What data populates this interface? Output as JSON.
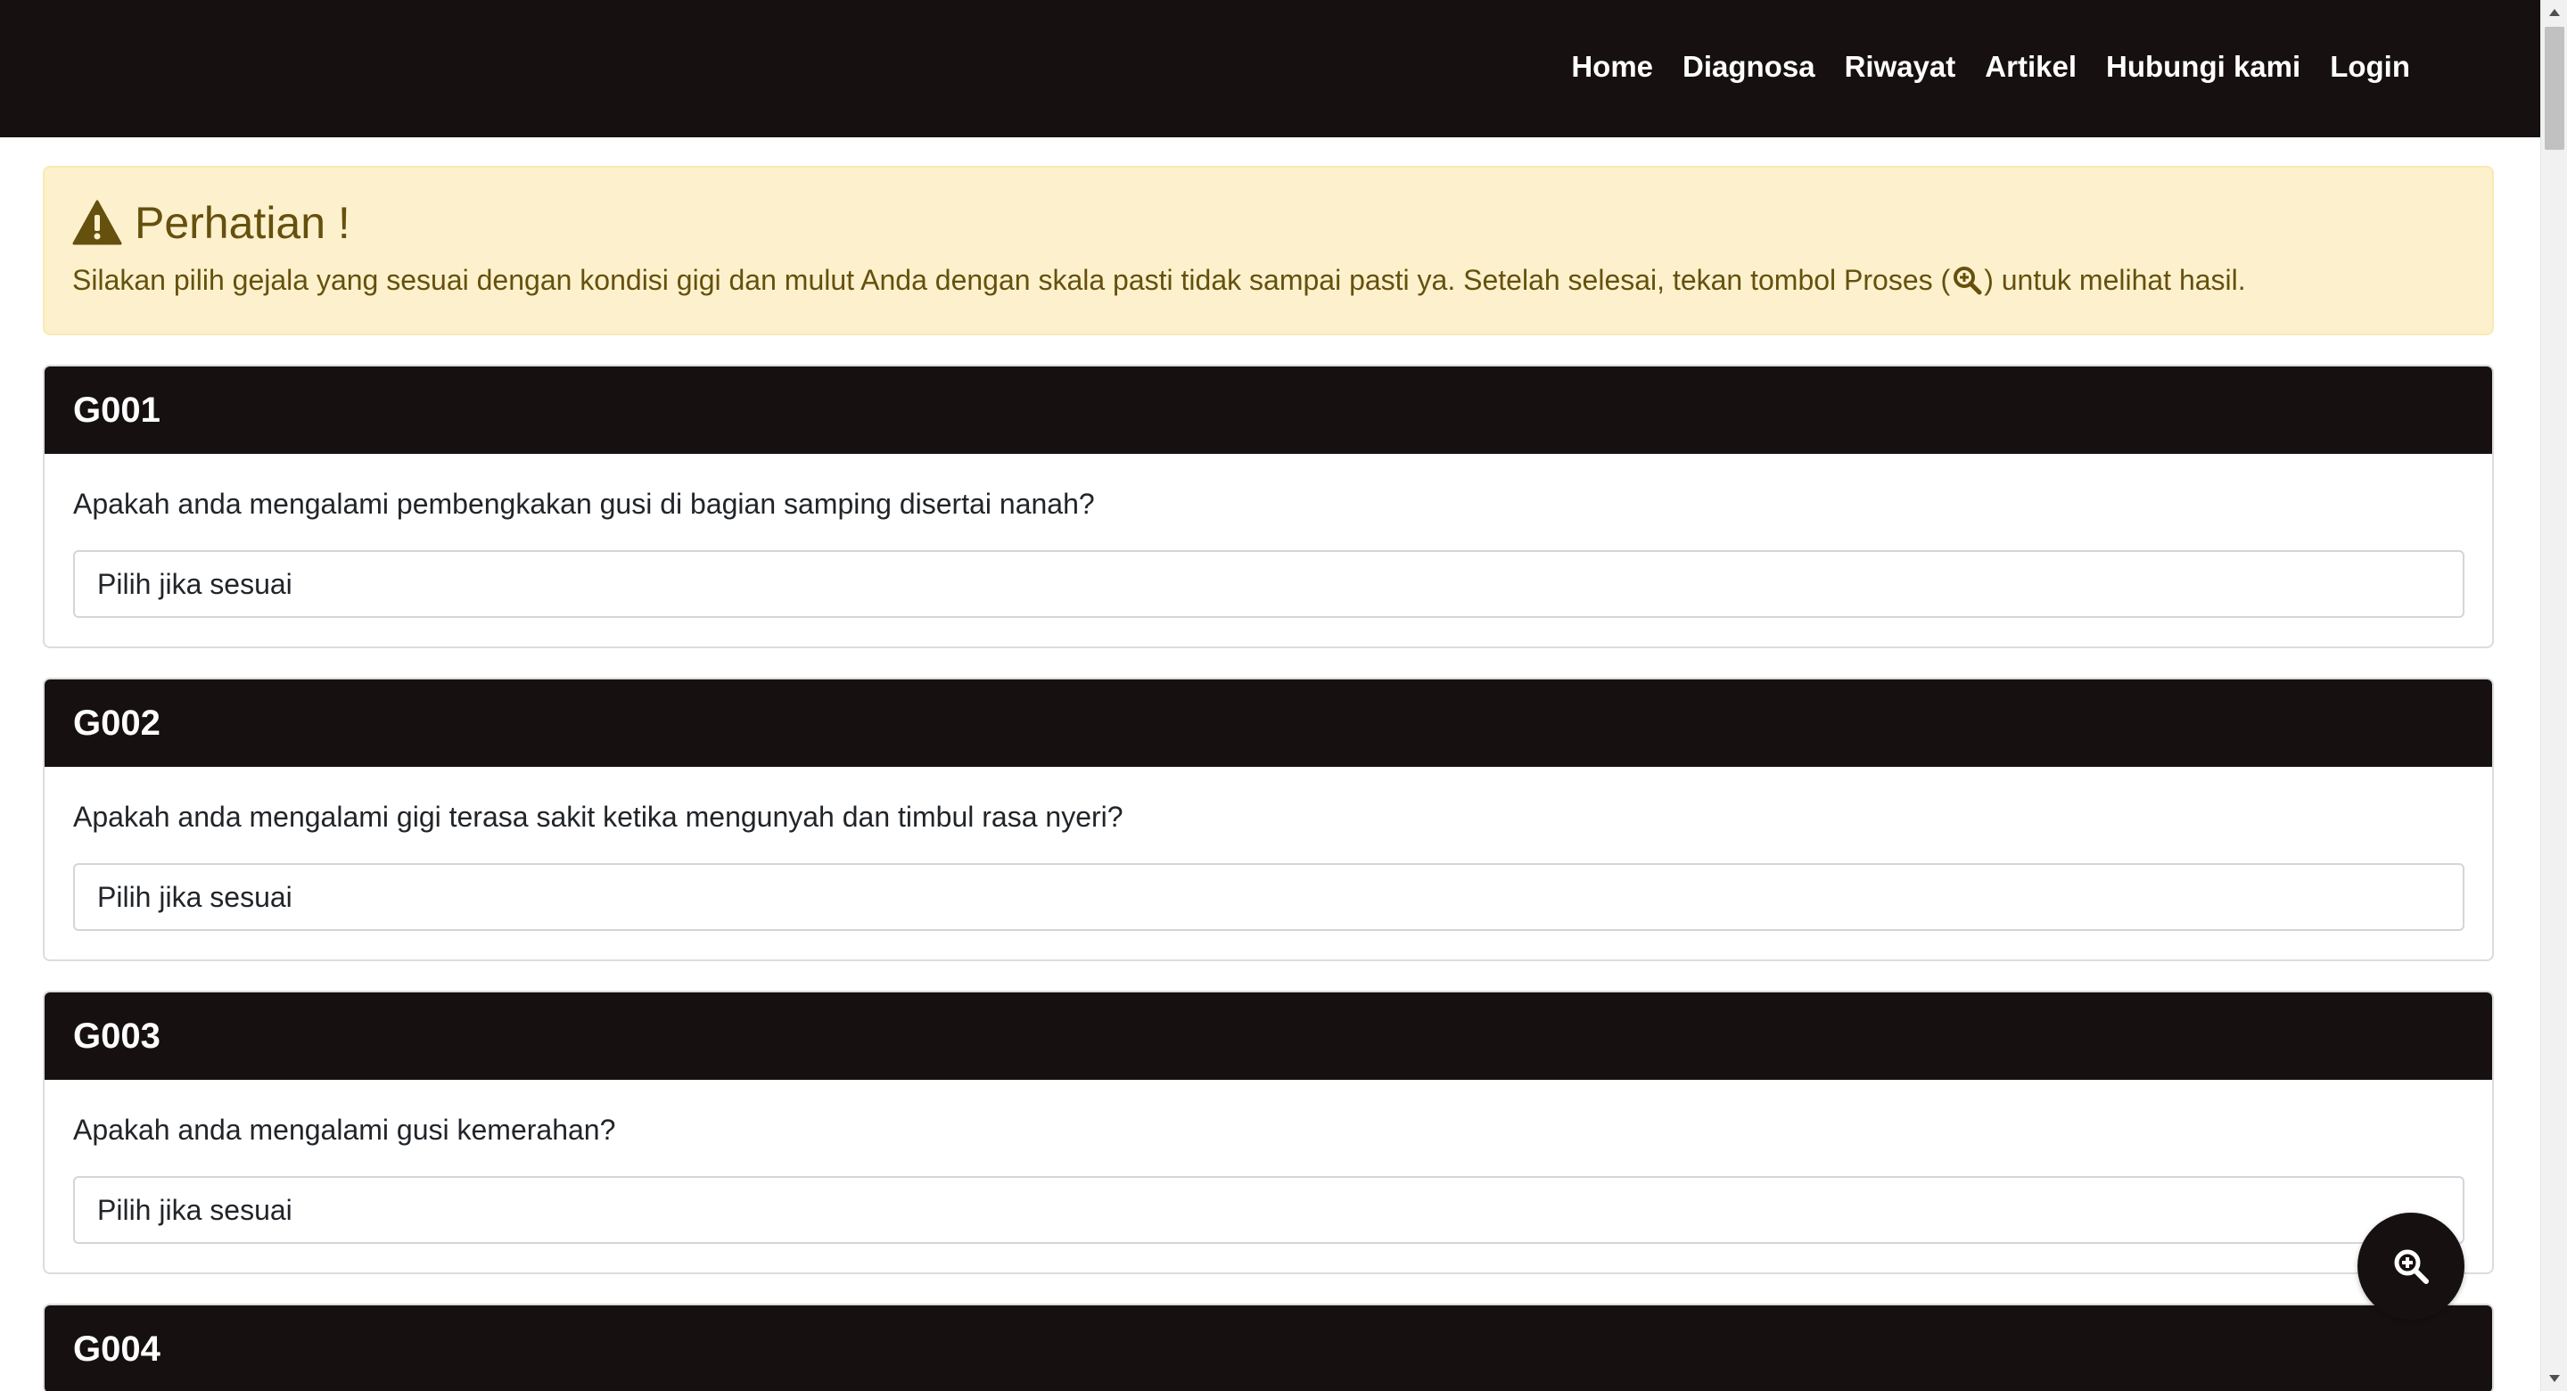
{
  "nav": {
    "items": [
      {
        "label": "Home"
      },
      {
        "label": "Diagnosa"
      },
      {
        "label": "Riwayat"
      },
      {
        "label": "Artikel"
      },
      {
        "label": "Hubungi kami"
      },
      {
        "label": "Login"
      }
    ]
  },
  "alert": {
    "title": "Perhatian !",
    "text_before": "Silakan pilih gejala yang sesuai dengan kondisi gigi dan mulut Anda dengan skala pasti tidak sampai pasti ya. Setelah selesai, tekan tombol Proses (",
    "text_after": ") untuk melihat hasil.",
    "icon": "warning-triangle-icon"
  },
  "symptoms": [
    {
      "code": "G001",
      "question": "Apakah anda mengalami pembengkakan gusi di bagian samping disertai nanah?",
      "select_value": "Pilih jika sesuai"
    },
    {
      "code": "G002",
      "question": "Apakah anda mengalami gigi terasa sakit ketika mengunyah dan timbul rasa nyeri?",
      "select_value": "Pilih jika sesuai"
    },
    {
      "code": "G003",
      "question": "Apakah anda mengalami gusi kemerahan?",
      "select_value": "Pilih jika sesuai"
    },
    {
      "code": "G004"
    }
  ],
  "fab": {
    "icon": "zoom-in-icon"
  },
  "colors": {
    "navbar_bg": "#161110",
    "alert_bg": "#fcf1cc",
    "alert_text": "#65500e",
    "card_header_bg": "#161110"
  }
}
